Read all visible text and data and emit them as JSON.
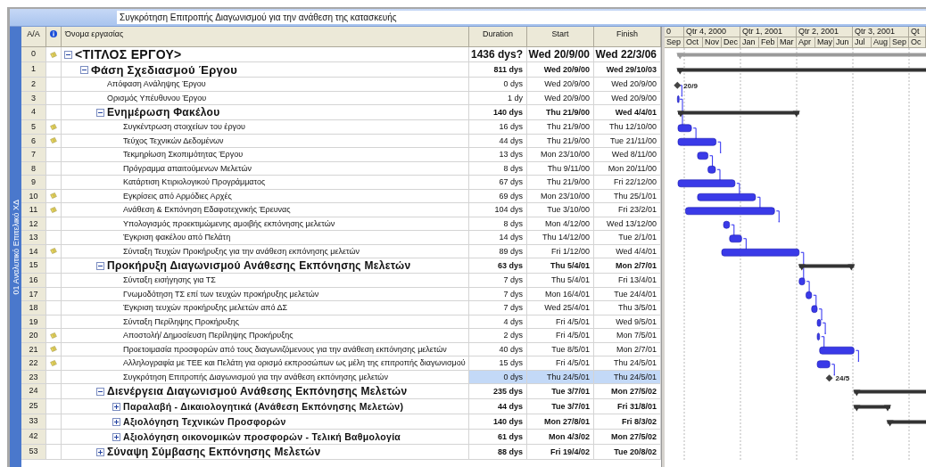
{
  "entry_bar": {
    "value": "Συγκρότηση Επιτροπής Διαγωνισμού για την ανάθεση της κατασκευής"
  },
  "side_label": "01 Αναλυτικό Επιτελικό ΧΔ",
  "columns": {
    "id": "A/A",
    "name": "Όνομα εργασίας",
    "duration": "Duration",
    "start": "Start",
    "finish": "Finish"
  },
  "timescale": {
    "quarters": [
      "0",
      "Qtr 4, 2000",
      "Qtr 1, 2001",
      "Qtr 2, 2001",
      "Qtr 3, 2001",
      "Qt"
    ],
    "months": [
      "Sep",
      "Oct",
      "Nov",
      "Dec",
      "Jan",
      "Feb",
      "Mar",
      "Apr",
      "May",
      "Jun",
      "Jul",
      "Aug",
      "Sep",
      "Oc"
    ]
  },
  "rows": [
    {
      "id": "0",
      "name": "<ΤΙΤΛΟΣ ΕΡΓΟΥ>",
      "kind": "project",
      "expanded": true,
      "note": true,
      "duration": "1436 dys?",
      "start": "Wed 20/9/00",
      "finish": "Wed 22/3/06",
      "selected": false,
      "children": [
        {
          "id": "1",
          "name": "Φάση Σχεδιασμού Έργου",
          "kind": "summary",
          "expanded": true,
          "note": false,
          "duration": "811 dys",
          "start": "Wed 20/9/00",
          "finish": "Wed 29/10/03",
          "selected": false,
          "children": [
            {
              "id": "2",
              "name": "Απόφαση Ανάληψης Έργου",
              "kind": "milestone",
              "note": false,
              "duration": "0 dys",
              "start": "Wed 20/9/00",
              "finish": "Wed 20/9/00",
              "selected": false,
              "milestone_label": "20/9"
            },
            {
              "id": "3",
              "name": "Ορισμός Υπέυθυνου Έργου",
              "kind": "task",
              "note": false,
              "duration": "1 dy",
              "start": "Wed 20/9/00",
              "finish": "Wed 20/9/00",
              "selected": false
            },
            {
              "id": "4",
              "name": "Ενημέρωση Φακέλου",
              "kind": "summary",
              "expanded": true,
              "note": false,
              "duration": "140 dys",
              "start": "Thu 21/9/00",
              "finish": "Wed 4/4/01",
              "selected": false,
              "children": [
                {
                  "id": "5",
                  "name": "Συγκέντρωση στοιχείων του έργου",
                  "kind": "task",
                  "note": true,
                  "duration": "16 dys",
                  "start": "Thu 21/9/00",
                  "finish": "Thu 12/10/00",
                  "selected": false
                },
                {
                  "id": "6",
                  "name": "Τεύχος Τεχνικών Δεδομένων",
                  "kind": "task",
                  "note": true,
                  "duration": "44 dys",
                  "start": "Thu 21/9/00",
                  "finish": "Tue 21/11/00",
                  "selected": false
                },
                {
                  "id": "7",
                  "name": "Τεκμηρίωση Σκοπιμότητας  Έργου",
                  "kind": "task",
                  "note": false,
                  "duration": "13 dys",
                  "start": "Mon 23/10/00",
                  "finish": "Wed 8/11/00",
                  "selected": false
                },
                {
                  "id": "8",
                  "name": "Πρόγραμμα απαιτούμενων Μελετών",
                  "kind": "task",
                  "note": false,
                  "duration": "8 dys",
                  "start": "Thu 9/11/00",
                  "finish": "Mon 20/11/00",
                  "selected": false
                },
                {
                  "id": "9",
                  "name": "Κατάρτιση Κτιριολογικού Προγράμματος",
                  "kind": "task",
                  "note": false,
                  "duration": "67 dys",
                  "start": "Thu 21/9/00",
                  "finish": "Fri 22/12/00",
                  "selected": false
                },
                {
                  "id": "10",
                  "name": "Εγκρίσεις από Αρμόδιες Αρχές",
                  "kind": "task",
                  "note": true,
                  "duration": "69 dys",
                  "start": "Mon 23/10/00",
                  "finish": "Thu 25/1/01",
                  "selected": false
                },
                {
                  "id": "11",
                  "name": "Ανάθεση & Εκπόνηση Εδαφοτεχνικής Έρευνας",
                  "kind": "task",
                  "note": true,
                  "duration": "104 dys",
                  "start": "Tue 3/10/00",
                  "finish": "Fri 23/2/01",
                  "selected": false
                },
                {
                  "id": "12",
                  "name": "Υπολογισμός προεκτιμώμενης αμοιβής εκπόνησης μελετών",
                  "kind": "task",
                  "note": false,
                  "duration": "8 dys",
                  "start": "Mon 4/12/00",
                  "finish": "Wed 13/12/00",
                  "selected": false
                },
                {
                  "id": "13",
                  "name": "Έγκριση φακέλου από Πελάτη",
                  "kind": "task",
                  "note": false,
                  "duration": "14 dys",
                  "start": "Thu 14/12/00",
                  "finish": "Tue 2/1/01",
                  "selected": false
                },
                {
                  "id": "14",
                  "name": "Σύνταξη Τευχών Προκήρυξης για την ανάθεση εκπόνησης μελετών",
                  "kind": "task",
                  "note": true,
                  "duration": "89 dys",
                  "start": "Fri 1/12/00",
                  "finish": "Wed 4/4/01",
                  "selected": false
                }
              ]
            },
            {
              "id": "15",
              "name": "Προκήρυξη Διαγωνισμού Ανάθεσης Εκπόνησης Μελετών",
              "kind": "summary",
              "expanded": true,
              "note": false,
              "duration": "63 dys",
              "start": "Thu 5/4/01",
              "finish": "Mon 2/7/01",
              "selected": false,
              "children": [
                {
                  "id": "16",
                  "name": "Σύνταξη εισήγησης για ΤΣ",
                  "kind": "task",
                  "note": false,
                  "duration": "7 dys",
                  "start": "Thu 5/4/01",
                  "finish": "Fri 13/4/01",
                  "selected": false
                },
                {
                  "id": "17",
                  "name": "Γνωμοδότηση ΤΣ επί των τευχών προκήρυξης μελετών",
                  "kind": "task",
                  "note": false,
                  "duration": "7 dys",
                  "start": "Mon 16/4/01",
                  "finish": "Tue 24/4/01",
                  "selected": false
                },
                {
                  "id": "18",
                  "name": "Έγκριση τευχών προκήρυξης μελετών από ΔΣ",
                  "kind": "task",
                  "note": false,
                  "duration": "7 dys",
                  "start": "Wed 25/4/01",
                  "finish": "Thu 3/5/01",
                  "selected": false
                },
                {
                  "id": "19",
                  "name": "Σύνταξη Περίληψης Προκήρυξης",
                  "kind": "task",
                  "note": false,
                  "duration": "4 dys",
                  "start": "Fri 4/5/01",
                  "finish": "Wed 9/5/01",
                  "selected": false
                },
                {
                  "id": "20",
                  "name": "Αποστολή/ Δημοσίευση Περίληψης Προκήρυξης",
                  "kind": "task",
                  "note": true,
                  "duration": "2 dys",
                  "start": "Fri 4/5/01",
                  "finish": "Mon 7/5/01",
                  "selected": false
                },
                {
                  "id": "21",
                  "name": "Προετοιμασία προσφορών από τους διαγωνιζόμενους για την ανάθεση εκπόνησης μελετών",
                  "kind": "task",
                  "note": true,
                  "duration": "40 dys",
                  "start": "Tue 8/5/01",
                  "finish": "Mon 2/7/01",
                  "selected": false
                },
                {
                  "id": "22",
                  "name": "Αλληλογραφία με ΤΕΕ και Πελάτη για ορισμό εκπροσώπων ως μέλη της επιτροπής διαγωνισμού",
                  "kind": "task",
                  "note": true,
                  "duration": "15 dys",
                  "start": "Fri 4/5/01",
                  "finish": "Thu 24/5/01",
                  "selected": false
                },
                {
                  "id": "23",
                  "name": "Συγκρότηση Επιτροπής Διαγωνισμού για την ανάθεση εκπόνησης μελετών",
                  "kind": "milestone",
                  "note": false,
                  "duration": "0 dys",
                  "start": "Thu 24/5/01",
                  "finish": "Thu 24/5/01",
                  "selected": true,
                  "milestone_label": "24/5"
                }
              ]
            },
            {
              "id": "24",
              "name": "Διενέργεια Διαγωνισμού Ανάθεσης Εκπόνησης Μελετών",
              "kind": "summary",
              "expanded": true,
              "note": false,
              "duration": "235 dys",
              "start": "Tue 3/7/01",
              "finish": "Mon 27/5/02",
              "selected": false,
              "children": [
                {
                  "id": "25",
                  "name": "Παραλαβή - Δικαιολογητικά (Ανάθεση Εκπόνησης Μελετών)",
                  "kind": "summary",
                  "expanded": false,
                  "note": false,
                  "duration": "44 dys",
                  "start": "Tue 3/7/01",
                  "finish": "Fri 31/8/01",
                  "selected": false
                },
                {
                  "id": "33",
                  "name": "Αξιολόγηση Τεχνικών Προσφορών",
                  "kind": "summary",
                  "expanded": false,
                  "note": false,
                  "duration": "140 dys",
                  "start": "Mon 27/8/01",
                  "finish": "Fri 8/3/02",
                  "selected": false
                },
                {
                  "id": "42",
                  "name": "Αξιολόγηση οικονομικών προσφορών - Τελική Βαθμολογία",
                  "kind": "summary",
                  "expanded": false,
                  "note": false,
                  "duration": "61 dys",
                  "start": "Mon 4/3/02",
                  "finish": "Mon 27/5/02",
                  "selected": false
                }
              ]
            },
            {
              "id": "53",
              "name": "Σύναψη Σύμβασης Εκπόνησης Μελετών",
              "kind": "summary",
              "expanded": false,
              "note": false,
              "duration": "88 dys",
              "start": "Fri 19/4/02",
              "finish": "Tue 20/8/02",
              "selected": false
            }
          ]
        }
      ]
    }
  ]
}
